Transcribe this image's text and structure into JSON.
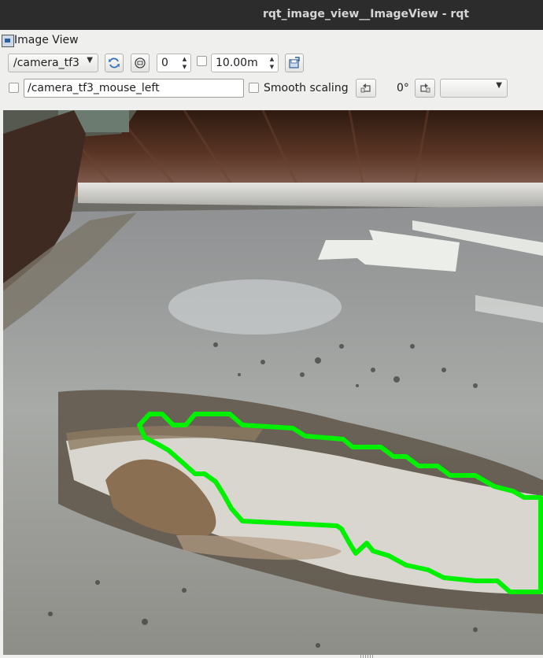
{
  "window": {
    "title": "rqt_image_view__ImageView - rqt"
  },
  "plugin": {
    "title": "Image View"
  },
  "toolbar": {
    "topic": "/camera_tf3",
    "spin_value": "0",
    "distance_value": "10.00m",
    "publish_topic": "/camera_tf3_mouse_left",
    "smooth_scaling_label": "Smooth scaling",
    "rotation_label": "0°",
    "rotation_select": ""
  },
  "image": {
    "overlay_color": "#00f000",
    "icons": [
      "refresh-icon",
      "zoom-fit-icon",
      "save-icon",
      "rotate-left-icon",
      "rotate-right-icon"
    ]
  }
}
